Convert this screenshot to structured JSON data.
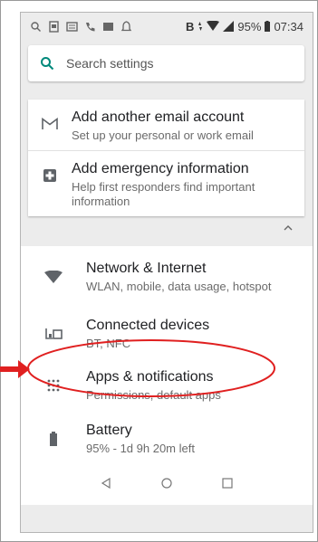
{
  "statusbar": {
    "network_label": "B",
    "battery_percent": "95%",
    "time": "07:34"
  },
  "search": {
    "placeholder": "Search settings",
    "icon": "search-icon"
  },
  "suggestions": [
    {
      "title": "Add another email account",
      "subtitle": "Set up your personal or work email",
      "icon": "gmail-icon"
    },
    {
      "title": "Add emergency information",
      "subtitle": "Help first responders find important information",
      "icon": "emergency-info-icon"
    }
  ],
  "settings": [
    {
      "title": "Network & Internet",
      "subtitle": "WLAN, mobile, data usage, hotspot",
      "icon": "wifi-icon"
    },
    {
      "title": "Connected devices",
      "subtitle": "BT, NFC",
      "icon": "connected-devices-icon"
    },
    {
      "title": "Apps & notifications",
      "subtitle": "Permissions, default apps",
      "icon": "apps-grid-icon"
    },
    {
      "title": "Battery",
      "subtitle": "95% - 1d 9h 20m left",
      "icon": "battery-icon"
    }
  ],
  "navbar": [
    "back-icon",
    "home-icon",
    "recents-icon"
  ],
  "colors": {
    "accent": "#00897b",
    "annotation": "#e02020",
    "background": "#ececec"
  }
}
